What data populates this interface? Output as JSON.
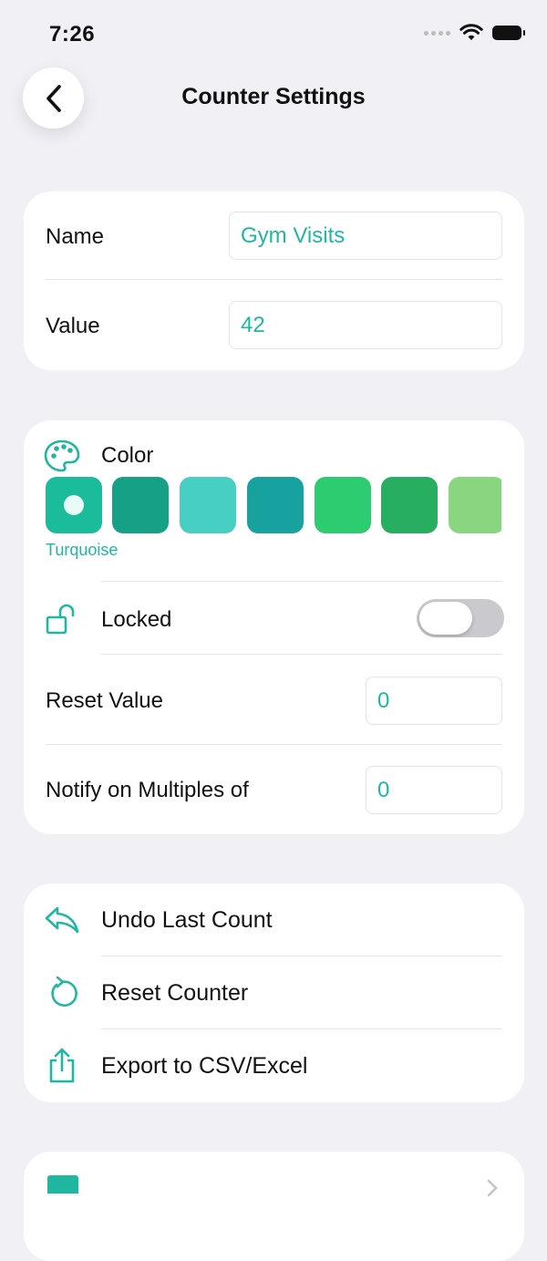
{
  "status_bar": {
    "time": "7:26"
  },
  "header": {
    "title": "Counter Settings"
  },
  "basic": {
    "name_label": "Name",
    "name_value": "Gym Visits",
    "value_label": "Value",
    "value_value": "42"
  },
  "style": {
    "color_label": "Color",
    "selected_color_name": "Turquoise",
    "swatches": [
      "#1abc9c",
      "#16a085",
      "#48cfc4",
      "#17a2a0",
      "#2ecc71",
      "#27ae60",
      "#88d67f"
    ],
    "locked_label": "Locked",
    "locked": false,
    "reset_value_label": "Reset Value",
    "reset_value": "0",
    "notify_label": "Notify on Multiples of",
    "notify_value": "0"
  },
  "actions": {
    "undo_label": "Undo Last Count",
    "reset_label": "Reset Counter",
    "export_label": "Export to CSV/Excel"
  },
  "colors": {
    "accent": "#20b7a0",
    "background": "#f0f0f5",
    "toggle_off": "#c9c9ce"
  }
}
